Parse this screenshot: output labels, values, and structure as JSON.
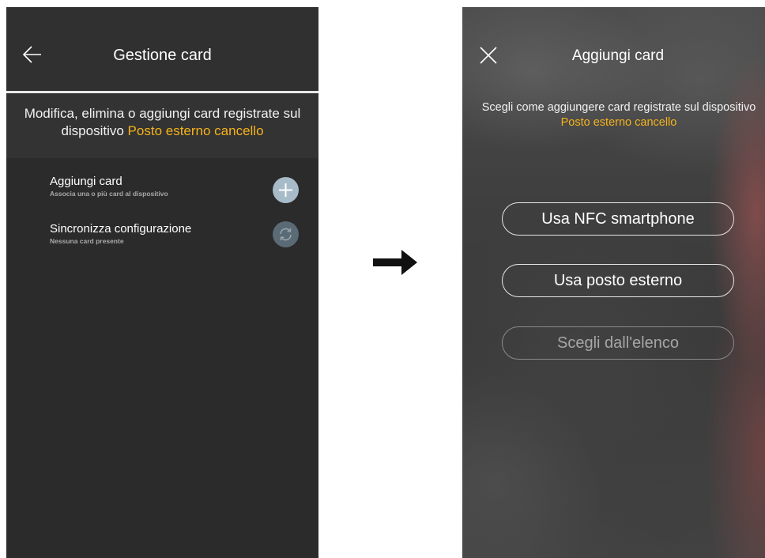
{
  "left_screen": {
    "title": "Gestione card",
    "description": "Modifica, elimina o aggiungi card registrate sul dispositivo",
    "device_name": "Posto esterno cancello",
    "items": [
      {
        "label": "Aggiungi card",
        "subtitle": "Associa una o più card al dispositivo",
        "icon": "plus-icon"
      },
      {
        "label": "Sincronizza configurazione",
        "subtitle": "Nessuna card presente",
        "icon": "sync-icon"
      }
    ]
  },
  "right_screen": {
    "title": "Aggiungi card",
    "description": "Scegli come aggiungere card registrate sul dispositivo",
    "device_name": "Posto esterno cancello",
    "options": [
      {
        "label": "Usa NFC smartphone",
        "enabled": true
      },
      {
        "label": "Usa posto esterno",
        "enabled": true
      },
      {
        "label": "Scegli dall'elenco",
        "enabled": false
      }
    ]
  },
  "icons": {
    "back": "arrow-left-icon",
    "close": "close-icon",
    "flow": "arrow-right-icon"
  },
  "colors": {
    "accent": "#f5b21b",
    "background_dark": "#2b2b2b",
    "add_button": "#a8bbc9",
    "sync_button": "#5a6b76"
  }
}
